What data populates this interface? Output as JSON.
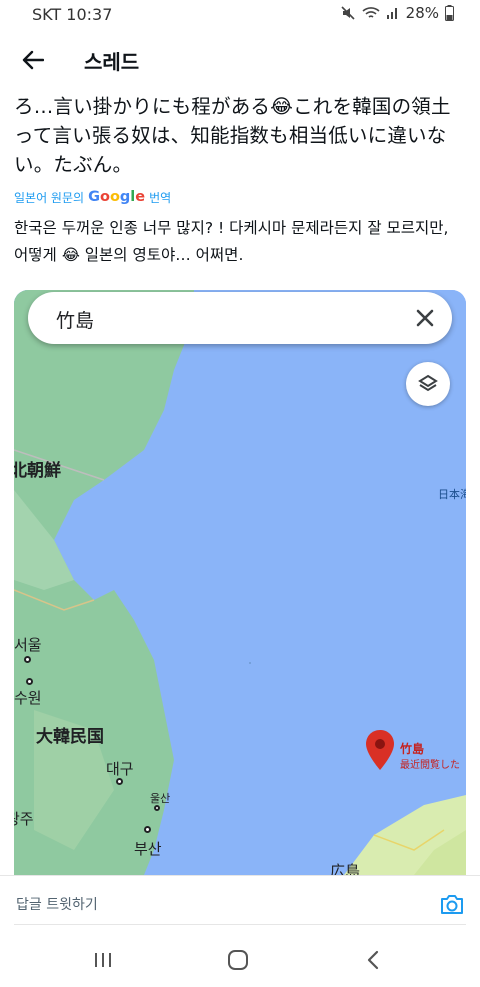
{
  "status": {
    "time": "SKT 10:37",
    "battery": "28%",
    "icons": [
      "mute-icon",
      "wifi-icon",
      "signal-icon",
      "battery-icon"
    ]
  },
  "header": {
    "title": "스레드",
    "back_icon": "back-arrow-icon"
  },
  "tweet": {
    "original_text": "ろ…言い掛かりにも程がある😂これを韓国の領土って言い張る奴は、知能指数も相当低いに違いない。たぶん。",
    "translate_prefix": "일본어 원문의",
    "translate_brand": "Google",
    "translate_suffix": "번역",
    "translated_text": "한국은 두꺼운 인종 너무 많지? ! 다케시마 문제라든지 잘 모르지만, 어떻게 😂 일본의 영토야… 어쩌면."
  },
  "map": {
    "search_query": "竹島",
    "labels": {
      "north_korea": "北朝鮮",
      "sea_of_japan": "日本海",
      "seoul": "서울",
      "suwon": "수원",
      "korea": "大韓民国",
      "daegu": "대구",
      "ulsan": "울산",
      "gwangju": "광주",
      "busan": "부산",
      "hiroshima": "広島",
      "pin_name": "竹島",
      "pin_sub": "最近閲覧した"
    },
    "colors": {
      "sea": "#8ab4f8",
      "land": "#8fc9a0",
      "pin": "#d93025"
    }
  },
  "reply": {
    "placeholder": "답글 트윗하기",
    "camera_icon": "camera-icon"
  },
  "nav": {
    "icons": [
      "recent-apps-icon",
      "home-icon",
      "nav-back-icon"
    ]
  }
}
